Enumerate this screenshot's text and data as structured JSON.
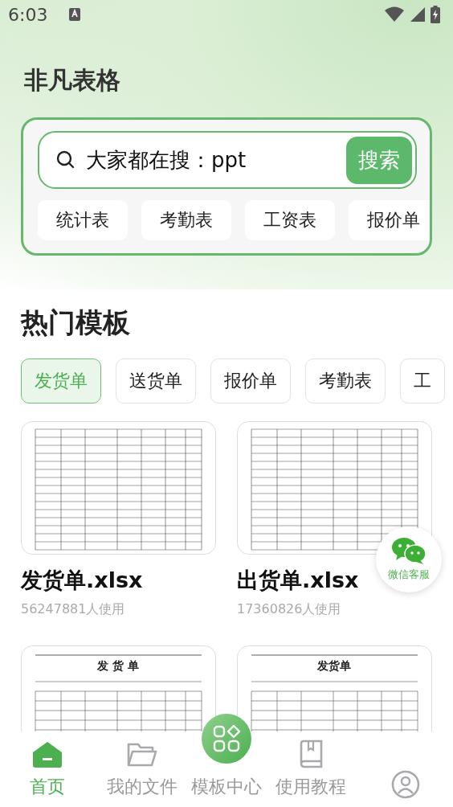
{
  "status_bar": {
    "time": "6:03"
  },
  "app_title": "非凡表格",
  "search": {
    "placeholder": "大家都在搜：ppt",
    "button": "搜索"
  },
  "quick_tags": [
    "统计表",
    "考勤表",
    "工资表",
    "报价单"
  ],
  "section_title": "热门模板",
  "categories": [
    {
      "label": "发货单",
      "selected": true
    },
    {
      "label": "送货单",
      "selected": false
    },
    {
      "label": "报价单",
      "selected": false
    },
    {
      "label": "考勤表",
      "selected": false
    },
    {
      "label": "工",
      "selected": false
    }
  ],
  "templates": [
    {
      "name": "发货单.xlsx",
      "usage": "56247881人使用"
    },
    {
      "name": "出货单.xlsx",
      "usage": "17360826人使用"
    },
    {
      "preview_title": "发 货 单"
    },
    {
      "preview_title": "发货单"
    }
  ],
  "float_button": {
    "label": "微信客服"
  },
  "nav": [
    {
      "label": "首页",
      "kind": "home",
      "selected": true
    },
    {
      "label": "我的文件",
      "kind": "folder",
      "selected": false
    },
    {
      "label": "模板中心",
      "kind": "apps",
      "selected": false
    },
    {
      "label": "使用教程",
      "kind": "book",
      "selected": false
    },
    {
      "kind": "user",
      "selected": false
    }
  ]
}
